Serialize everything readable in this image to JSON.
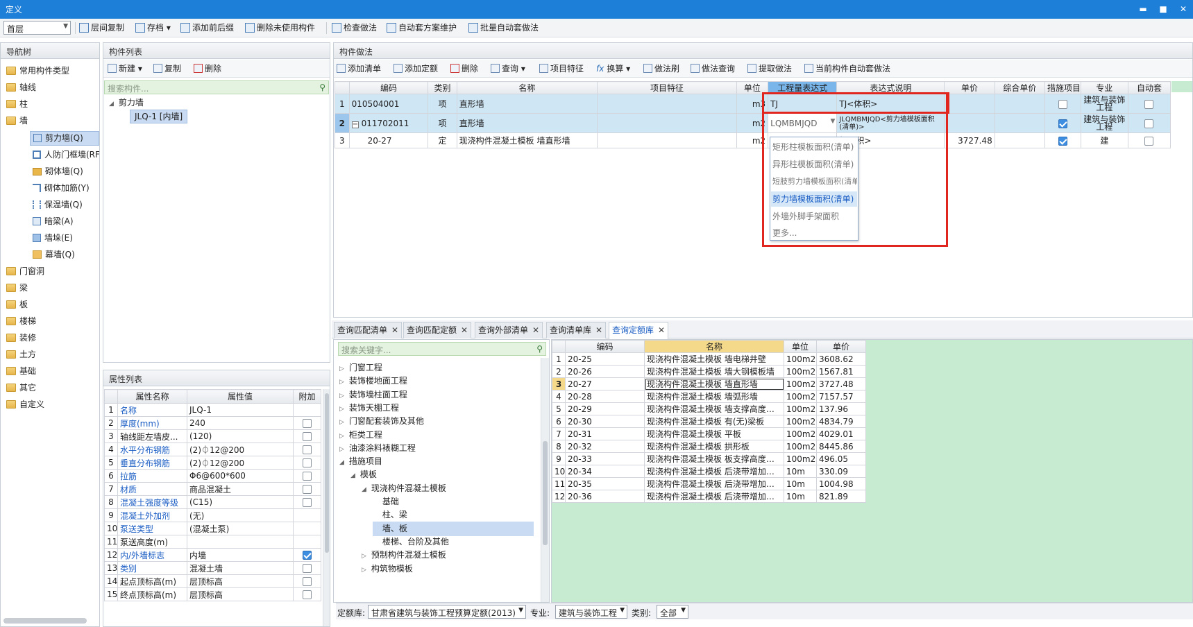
{
  "window": {
    "title": "定义",
    "controls": [
      "▬",
      "■",
      "✕"
    ]
  },
  "toolbar": {
    "floor": "首层",
    "buttons": [
      "层间复制",
      "存档",
      "添加前后缀",
      "删除未使用构件",
      "检查做法",
      "自动套方案维护",
      "批量自动套做法"
    ]
  },
  "nav": {
    "title": "导航树",
    "items": [
      {
        "label": "常用构件类型",
        "expand": "+"
      },
      {
        "label": "轴线",
        "expand": "+"
      },
      {
        "label": "柱",
        "expand": "+"
      },
      {
        "label": "墙",
        "expand": "-"
      }
    ],
    "wall_children": [
      "剪力墙(Q)",
      "人防门框墙(RF",
      "砌体墙(Q)",
      "砌体加筋(Y)",
      "保温墙(Q)",
      "暗梁(A)",
      "墙垛(E)",
      "幕墙(Q)"
    ],
    "items2": [
      "门窗洞",
      "梁",
      "板",
      "楼梯",
      "装修",
      "土方",
      "基础",
      "其它",
      "自定义"
    ]
  },
  "comp_list": {
    "title": "构件列表",
    "buttons": [
      "新建",
      "复制",
      "删除"
    ],
    "search_placeholder": "搜索构件...",
    "group": "剪力墙",
    "item": "JLQ-1 [内墙]"
  },
  "props": {
    "title": "属性列表",
    "headers": [
      "属性名称",
      "属性值",
      "附加"
    ],
    "rows": [
      {
        "n": "1",
        "name": "名称",
        "val": "JLQ-1",
        "blue": true,
        "chk": null
      },
      {
        "n": "2",
        "name": "厚度(mm)",
        "val": "240",
        "blue": true,
        "chk": false
      },
      {
        "n": "3",
        "name": "轴线距左墙皮...",
        "val": "(120)",
        "blue": false,
        "chk": false
      },
      {
        "n": "4",
        "name": "水平分布钢筋",
        "val": "(2)⏀12@200",
        "blue": true,
        "chk": false
      },
      {
        "n": "5",
        "name": "垂直分布钢筋",
        "val": "(2)⏀12@200",
        "blue": true,
        "chk": false
      },
      {
        "n": "6",
        "name": "拉筋",
        "val": "Φ6@600*600",
        "blue": true,
        "chk": false
      },
      {
        "n": "7",
        "name": "材质",
        "val": "商品混凝土",
        "blue": true,
        "chk": false
      },
      {
        "n": "8",
        "name": "混凝土强度等级",
        "val": "(C15)",
        "blue": true,
        "chk": false
      },
      {
        "n": "9",
        "name": "混凝土外加剂",
        "val": "(无)",
        "blue": true,
        "chk": null
      },
      {
        "n": "10",
        "name": "泵送类型",
        "val": "(混凝土泵)",
        "blue": true,
        "chk": null
      },
      {
        "n": "11",
        "name": "泵送高度(m)",
        "val": "",
        "blue": false,
        "chk": null
      },
      {
        "n": "12",
        "name": "内/外墙标志",
        "val": "内墙",
        "blue": true,
        "chk": true
      },
      {
        "n": "13",
        "name": "类别",
        "val": "混凝土墙",
        "blue": true,
        "chk": false
      },
      {
        "n": "14",
        "name": "起点顶标高(m)",
        "val": "层顶标高",
        "blue": false,
        "chk": false
      },
      {
        "n": "15",
        "name": "终点顶标高(m)",
        "val": "层顶标高",
        "blue": false,
        "chk": false
      }
    ]
  },
  "method": {
    "title": "构件做法",
    "buttons": [
      "添加清单",
      "添加定额",
      "删除",
      "查询",
      "项目特征",
      "换算",
      "做法刷",
      "做法查询",
      "提取做法",
      "当前构件自动套做法"
    ],
    "headers": [
      "编码",
      "类别",
      "名称",
      "项目特征",
      "单位",
      "工程量表达式",
      "表达式说明",
      "单价",
      "综合单价",
      "措施项目",
      "专业",
      "自动套"
    ],
    "rows": [
      {
        "n": "1",
        "code": "010504001",
        "type": "项",
        "name": "直形墙",
        "unit": "m3",
        "expr": "TJ",
        "desc": "TJ<体积>",
        "price": "",
        "measure": false,
        "major": "建筑与装饰工程"
      },
      {
        "n": "2",
        "code": "011702011",
        "type": "项",
        "name": "直形墙",
        "unit": "m2",
        "expr": "LQMBMJQD",
        "desc": "JLQMBMJQD<剪力墙模板面积(清单)>",
        "price": "",
        "measure": true,
        "major": "建筑与装饰工程"
      },
      {
        "n": "3",
        "code": "20-27",
        "type": "定",
        "name": "现浇构件混凝土模板 墙直形墙",
        "unit": "m2",
        "expr": "",
        "desc": "板面积>",
        "price": "3727.48",
        "measure": true,
        "major": "建"
      }
    ],
    "dropdown": [
      "矩形柱模板面积(清单)",
      "异形柱模板面积(清单)",
      "短肢剪力墙模板面积(清单)",
      "剪力墙模板面积(清单)",
      "外墙外脚手架面积",
      "更多..."
    ]
  },
  "tabs": [
    "查询匹配清单",
    "查询匹配定额",
    "查询外部清单",
    "查询清单库",
    "查询定额库"
  ],
  "quota_tree": {
    "search_placeholder": "搜索关键字...",
    "items": [
      {
        "l": "门窗工程",
        "lv": 0,
        "t": "▷"
      },
      {
        "l": "装饰楼地面工程",
        "lv": 0,
        "t": "▷"
      },
      {
        "l": "装饰墙柱面工程",
        "lv": 0,
        "t": "▷"
      },
      {
        "l": "装饰天棚工程",
        "lv": 0,
        "t": "▷"
      },
      {
        "l": "门窗配套装饰及其他",
        "lv": 0,
        "t": "▷"
      },
      {
        "l": "柜类工程",
        "lv": 0,
        "t": "▷"
      },
      {
        "l": "油漆涂料裱糊工程",
        "lv": 0,
        "t": "▷"
      },
      {
        "l": "措施项目",
        "lv": 0,
        "t": "◢"
      },
      {
        "l": "模板",
        "lv": 1,
        "t": "◢"
      },
      {
        "l": "现浇构件混凝土模板",
        "lv": 2,
        "t": "◢"
      },
      {
        "l": "基础",
        "lv": 3,
        "t": ""
      },
      {
        "l": "柱、梁",
        "lv": 3,
        "t": ""
      },
      {
        "l": "墙、板",
        "lv": 3,
        "t": "",
        "sel": true
      },
      {
        "l": "楼梯、台阶及其他",
        "lv": 3,
        "t": ""
      },
      {
        "l": "预制构件混凝土模板",
        "lv": 2,
        "t": "▷"
      },
      {
        "l": "构筑物模板",
        "lv": 2,
        "t": "▷"
      }
    ]
  },
  "quota_table": {
    "headers": [
      "编码",
      "名称",
      "单位",
      "单价"
    ],
    "rows": [
      [
        "1",
        "20-25",
        "现浇构件混凝土模板 墙电梯井壁",
        "100m2",
        "3608.62"
      ],
      [
        "2",
        "20-26",
        "现浇构件混凝土模板 墙大钢模板墙",
        "100m2",
        "1567.81"
      ],
      [
        "3",
        "20-27",
        "现浇构件混凝土模板 墙直形墙",
        "100m2",
        "3727.48"
      ],
      [
        "4",
        "20-28",
        "现浇构件混凝土模板 墙弧形墙",
        "100m2",
        "7157.57"
      ],
      [
        "5",
        "20-29",
        "现浇构件混凝土模板 墙支撑高度…",
        "100m2",
        "137.96"
      ],
      [
        "6",
        "20-30",
        "现浇构件混凝土模板 有(无)梁板",
        "100m2",
        "4834.79"
      ],
      [
        "7",
        "20-31",
        "现浇构件混凝土模板 平板",
        "100m2",
        "4029.01"
      ],
      [
        "8",
        "20-32",
        "现浇构件混凝土模板 拱形板",
        "100m2",
        "8445.86"
      ],
      [
        "9",
        "20-33",
        "现浇构件混凝土模板 板支撑高度…",
        "100m2",
        "496.05"
      ],
      [
        "10",
        "20-34",
        "现浇构件混凝土模板 后浇带增加…",
        "10m",
        "330.09"
      ],
      [
        "11",
        "20-35",
        "现浇构件混凝土模板 后浇带增加…",
        "10m",
        "1004.98"
      ],
      [
        "12",
        "20-36",
        "现浇构件混凝土模板 后浇带增加…",
        "10m",
        "821.89"
      ]
    ]
  },
  "bottom": {
    "quota_lib_label": "定额库:",
    "quota_lib": "甘肃省建筑与装饰工程预算定额(2013)",
    "major_label": "专业:",
    "major": "建筑与装饰工程",
    "cat_label": "类别:",
    "cat": "全部"
  }
}
